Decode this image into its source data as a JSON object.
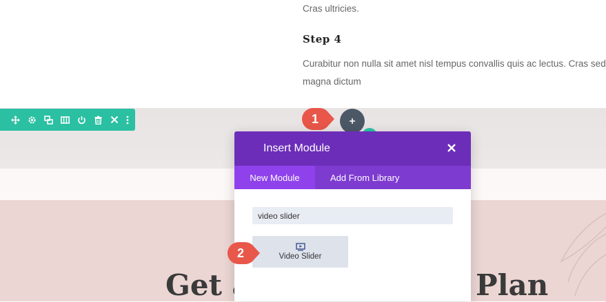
{
  "page": {
    "paragraph_1": "Cras ultricies.",
    "step_heading": "Step 4",
    "paragraph_2": "Curabitur non nulla sit amet nisl tempus convallis quis ac lectus. Cras sed magna dictum",
    "big_heading_left": "Get a",
    "big_heading_right": "Plan"
  },
  "row_toolbar": {
    "icons": [
      "move-icon",
      "gear-icon",
      "duplicate-icon",
      "columns-icon",
      "power-icon",
      "trash-icon",
      "close-icon",
      "more-vertical-icon"
    ]
  },
  "annotations": {
    "badge_1": "1",
    "badge_2": "2"
  },
  "modal": {
    "title": "Insert Module",
    "tabs": [
      {
        "label": "New Module",
        "active": true
      },
      {
        "label": "Add From Library",
        "active": false
      }
    ],
    "search": {
      "value": "video slider",
      "placeholder": ""
    },
    "results": [
      {
        "label": "Video Slider",
        "icon": "video-slider-icon"
      }
    ]
  },
  "colors": {
    "toolbar": "#2bc0a2",
    "modal_header": "#6c2eb9",
    "modal_tabs": "#7e3bd0",
    "tab_active": "#8f42ec",
    "badge": "#e8574a",
    "add_button": "#4c5866"
  }
}
